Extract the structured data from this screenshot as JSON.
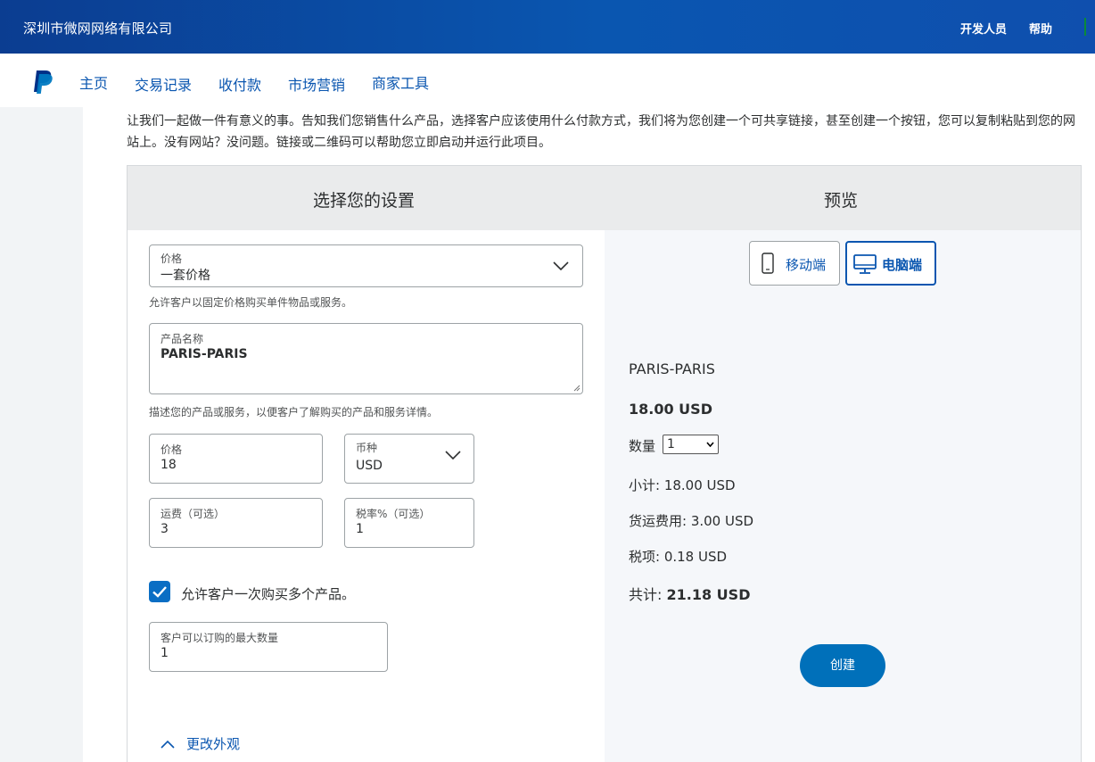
{
  "header": {
    "company": "深圳市微网网络有限公司",
    "developer": "开发人员",
    "help": "帮助"
  },
  "nav": {
    "items": [
      "主页",
      "交易记录",
      "收付款",
      "市场营销",
      "商家工具"
    ]
  },
  "intro": "让我们一起做一件有意义的事。告知我们您销售什么产品，选择客户应该使用什么付款方式，我们将为您创建一个可共享链接，甚至创建一个按钮，您可以复制粘贴到您的网站上。没有网站？没问题。链接或二维码可以帮助您立即启动并运行此项目。",
  "panel": {
    "settings_title": "选择您的设置",
    "preview_title": "预览"
  },
  "form": {
    "price_type": {
      "label": "价格",
      "value": "一套价格"
    },
    "price_type_help": "允许客户以固定价格购买单件物品或服务。",
    "product_name": {
      "label": "产品名称",
      "value": "PARIS-PARIS"
    },
    "product_name_help": "描述您的产品或服务，以便客户了解购买的产品和服务详情。",
    "price": {
      "label": "价格",
      "value": "18"
    },
    "currency": {
      "label": "币种",
      "value": "USD"
    },
    "shipping": {
      "label": "运费（可选）",
      "value": "3"
    },
    "tax_rate": {
      "label": "税率%（可选）",
      "value": "1"
    },
    "multi_qty": {
      "label": "允许客户一次购买多个产品。",
      "checked": true
    },
    "max_qty": {
      "label": "客户可以订购的最大数量",
      "value": "1"
    },
    "customize": "更改外观"
  },
  "preview": {
    "mobile_label": "移动端",
    "desktop_label": "电脑端",
    "active_view": "desktop",
    "product": "PARIS-PARIS",
    "price": "18.00 USD",
    "qty_label": "数量",
    "qty_value": "1",
    "subtotal": "小计: 18.00 USD",
    "shipping": "货运费用: 3.00 USD",
    "tax": "税项: 0.18 USD",
    "total_label": "共计:",
    "total_value": "21.18 USD",
    "create_button": "创建"
  },
  "colors": {
    "brand": "#0a56b0",
    "button": "#0070ba",
    "checkbox": "#0a6ec4"
  }
}
